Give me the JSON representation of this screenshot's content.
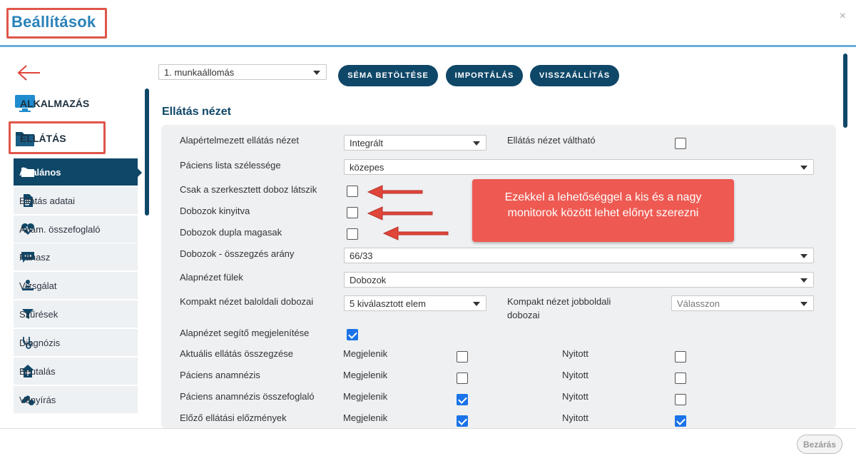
{
  "window": {
    "title": "Beállítások",
    "close_glyph": "×"
  },
  "footer": {
    "close_label": "Bezárás"
  },
  "sidebar": {
    "main": [
      {
        "label": "ALKALMAZÁS",
        "icon": "monitor-icon"
      },
      {
        "label": "ELLÁTÁS",
        "icon": "folder-icon"
      }
    ],
    "items": [
      {
        "label": "Általános",
        "icon": "folder-icon",
        "active": true
      },
      {
        "label": "Ellátás adatai",
        "icon": "document-icon"
      },
      {
        "label": "Anam. összefoglaló",
        "icon": "heart-pulse-icon"
      },
      {
        "label": "Panasz",
        "icon": "chat-icon"
      },
      {
        "label": "Vizsgálat",
        "icon": "exam-icon"
      },
      {
        "label": "Szűrések",
        "icon": "filter-icon"
      },
      {
        "label": "Diagnózis",
        "icon": "stethoscope-icon"
      },
      {
        "label": "Beutalás",
        "icon": "hospital-icon"
      },
      {
        "label": "Vényírás",
        "icon": "pills-icon"
      }
    ]
  },
  "toolbar": {
    "workstation": "1. munkaállomás",
    "load_schema": "SÉMA BETÖLTÉSE",
    "import": "IMPORTÁLÁS",
    "reset": "VISSZAÁLLÍTÁS"
  },
  "section": {
    "title": "Ellátás nézet"
  },
  "settings": {
    "default_view": {
      "label": "Alapértelmezett ellátás nézet",
      "value": "Integrált"
    },
    "view_switchable": {
      "label": "Ellátás nézet váltható",
      "checked": false
    },
    "patient_list_width": {
      "label": "Páciens lista szélessége",
      "value": "közepes"
    },
    "only_edited_box": {
      "label": "Csak a szerkesztett doboz látszik",
      "checked": false
    },
    "boxes_expanded": {
      "label": "Dobozok kinyitva",
      "checked": false
    },
    "boxes_double_height": {
      "label": "Dobozok dupla magasak",
      "checked": false
    },
    "boxes_summary_ratio": {
      "label": "Dobozok - összegzés arány",
      "value": "66/33"
    },
    "base_view_tabs": {
      "label": "Alapnézet fülek",
      "value": "Dobozok"
    },
    "compact_left": {
      "label": "Kompakt nézet baloldali dobozai",
      "value": "5 kiválasztott elem"
    },
    "compact_right": {
      "label_line1": "Kompakt nézet jobboldali",
      "label_line2": "dobozai",
      "value": "Válasszon"
    },
    "base_helper": {
      "label": "Alapnézet segítő megjelenítése",
      "checked": true
    },
    "rows": [
      {
        "label": "Aktuális ellátás összegzése",
        "show_label": "Megjelenik",
        "show": false,
        "open_label": "Nyitott",
        "open": false
      },
      {
        "label": "Páciens anamnézis",
        "show_label": "Megjelenik",
        "show": false,
        "open_label": "Nyitott",
        "open": false
      },
      {
        "label": "Páciens anamnézis összefoglaló",
        "show_label": "Megjelenik",
        "show": true,
        "open_label": "Nyitott",
        "open": false
      },
      {
        "label": "Előző ellátási előzmények",
        "show_label": "Megjelenik",
        "show": true,
        "open_label": "Nyitott",
        "open": true
      }
    ]
  },
  "callout": {
    "text": "Ezekkel a lehetőséggel a kis és a nagy monitorok között lehet előnyt szerezni"
  },
  "colors": {
    "accent": "#0f4768",
    "highlight": "#e0554a",
    "callout": "#ee5a52",
    "title": "#2a82b9"
  }
}
